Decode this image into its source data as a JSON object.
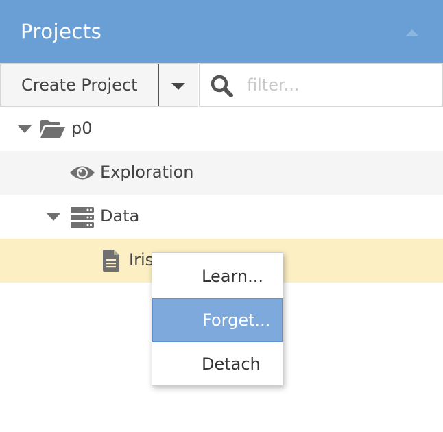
{
  "header": {
    "title": "Projects"
  },
  "toolbar": {
    "create_label": "Create Project",
    "filter_placeholder": "filter..."
  },
  "tree": {
    "items": [
      {
        "label": "p0",
        "icon": "folder-open-icon",
        "expanded": true
      },
      {
        "label": "Exploration",
        "icon": "eye-icon"
      },
      {
        "label": "Data",
        "icon": "server-icon",
        "expanded": true
      },
      {
        "label": "Iris",
        "icon": "file-icon",
        "selected": true
      }
    ]
  },
  "context_menu": {
    "items": [
      "Learn...",
      "Forget...",
      "Detach"
    ],
    "highlighted_item": "Forget..."
  },
  "colors": {
    "header_bg": "#6a9fd6",
    "selected_row_bg": "#fcefc4",
    "menu_highlight_bg": "#7ea9dc"
  }
}
